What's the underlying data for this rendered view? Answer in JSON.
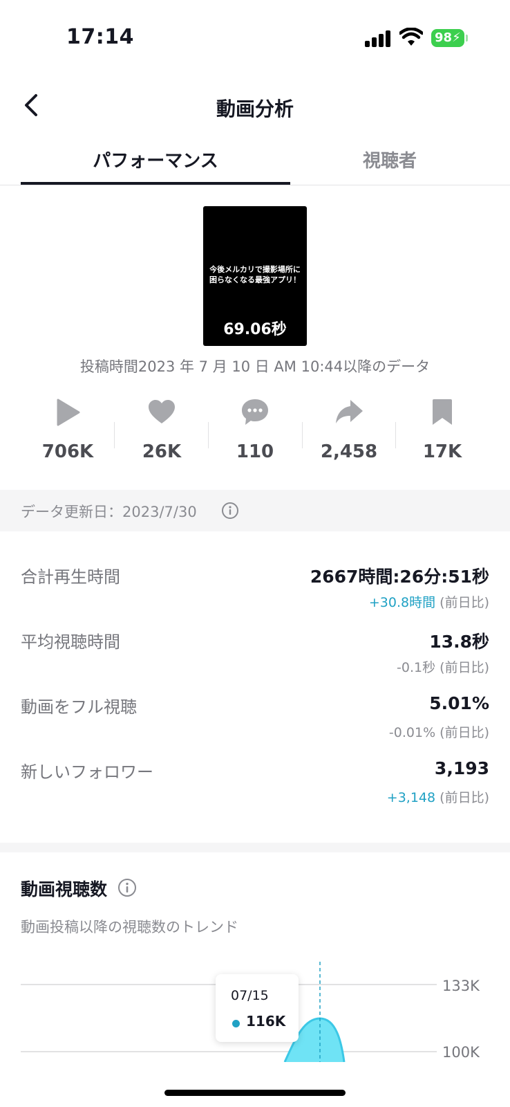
{
  "status_bar": {
    "time": "17:14",
    "battery": "98"
  },
  "nav": {
    "title": "動画分析"
  },
  "tabs": [
    {
      "label": "パフォーマンス",
      "active": true
    },
    {
      "label": "視聴者",
      "active": false
    }
  ],
  "video": {
    "caption": "今後メルカリで撮影場所に困らなくなる最強アプリ！",
    "duration": "69.06秒",
    "posted_note": "投稿時間2023 年 7 月 10 日 AM 10:44以降のデータ"
  },
  "stats": [
    {
      "icon": "play-icon",
      "value": "706K"
    },
    {
      "icon": "heart-icon",
      "value": "26K"
    },
    {
      "icon": "comment-icon",
      "value": "110"
    },
    {
      "icon": "share-icon",
      "value": "2,458"
    },
    {
      "icon": "bookmark-icon",
      "value": "17K"
    }
  ],
  "update": {
    "text": "データ更新日：2023/7/30"
  },
  "metrics": [
    {
      "label": "合計再生時間",
      "value": "2667時間:26分:51秒",
      "delta": "+30.8時間",
      "delta_suffix": " (前日比)",
      "delta_positive": true
    },
    {
      "label": "平均視聴時間",
      "value": "13.8秒",
      "delta": "-0.1秒",
      "delta_suffix": " (前日比)",
      "delta_positive": false
    },
    {
      "label": "動画をフル視聴",
      "value": "5.01%",
      "delta": "-0.01%",
      "delta_suffix": " (前日比)",
      "delta_positive": false
    },
    {
      "label": "新しいフォロワー",
      "value": "3,193",
      "delta": "+3,148",
      "delta_suffix": " (前日比)",
      "delta_positive": true
    }
  ],
  "views_chart": {
    "title": "動画視聴数",
    "subtitle": "動画投稿以降の視聴数のトレンド",
    "y_labels": [
      "133K",
      "100K"
    ],
    "tooltip": {
      "date": "07/15",
      "value": "116K"
    }
  },
  "colors": {
    "accent": "#20a1c4",
    "fill": "#6fe3f5",
    "text": "#161823",
    "muted": "#8a8b91"
  }
}
